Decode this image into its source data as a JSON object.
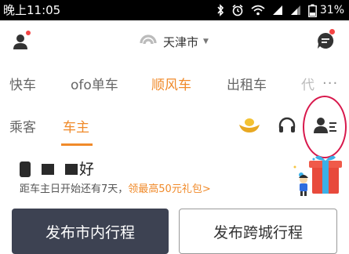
{
  "status_bar": {
    "time": "晚上11:05",
    "battery_percent": "31%"
  },
  "header": {
    "city": "天津市",
    "icons": [
      "user-icon",
      "didi-logo-icon",
      "message-icon",
      "caret-down-icon"
    ]
  },
  "service_tabs": [
    {
      "label": "快车",
      "active": false
    },
    {
      "label": "ofo单车",
      "active": false
    },
    {
      "label": "顺风车",
      "active": true
    },
    {
      "label": "出租车",
      "active": false
    },
    {
      "label": "代",
      "active": false
    }
  ],
  "role_tabs": [
    {
      "label": "乘客",
      "active": false
    },
    {
      "label": "车主",
      "active": true
    }
  ],
  "toolbar_icons": [
    "gold-ingot-icon",
    "headset-icon",
    "driver-profile-icon"
  ],
  "greeting": {
    "suffix": "好"
  },
  "promo": {
    "text": "距车主日开始还有7天，",
    "link": "领最高50元礼包>"
  },
  "actions": {
    "inner_city": "发布市内行程",
    "intercity": "发布跨城行程"
  },
  "colors": {
    "accent": "#f08a2a",
    "dark_button": "#3d4252",
    "badge_red": "#f44444",
    "annotation": "#d8184c"
  }
}
